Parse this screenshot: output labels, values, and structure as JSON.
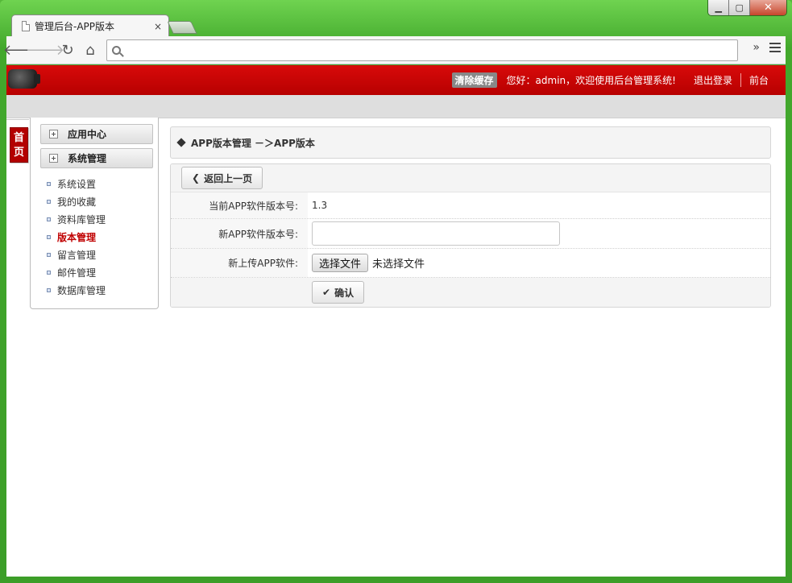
{
  "browser": {
    "tab_title": "管理后台-APP版本",
    "tab_close": "×",
    "url": "",
    "window_controls": {
      "minimize": "▁",
      "maximize": "▢",
      "close": "✕"
    }
  },
  "header": {
    "clear_cache": "清除缓存",
    "greeting": "您好：admin，欢迎使用后台管理系统!",
    "logout": "退出登录",
    "front": "前台"
  },
  "home_tab": "首页",
  "sidebar": {
    "groups": [
      "应用中心",
      "系统管理"
    ],
    "items": [
      {
        "label": "系统设置",
        "active": false
      },
      {
        "label": "我的收藏",
        "active": false
      },
      {
        "label": "资料库管理",
        "active": false
      },
      {
        "label": "版本管理",
        "active": true
      },
      {
        "label": "留言管理",
        "active": false
      },
      {
        "label": "邮件管理",
        "active": false
      },
      {
        "label": "数据库管理",
        "active": false
      }
    ]
  },
  "breadcrumb": "APP版本管理 －＞APP版本",
  "form": {
    "back_button": "返回上一页",
    "current_version_label": "当前APP软件版本号:",
    "current_version_value": "1.3",
    "new_version_label": "新APP软件版本号:",
    "new_version_value": "",
    "upload_label": "新上传APP软件:",
    "file_button": "选择文件",
    "file_status": "未选择文件",
    "submit_button": "确认"
  },
  "colors": {
    "header_red": "#c80000",
    "active_menu": "#c00000",
    "window_green": "#4fb536"
  }
}
